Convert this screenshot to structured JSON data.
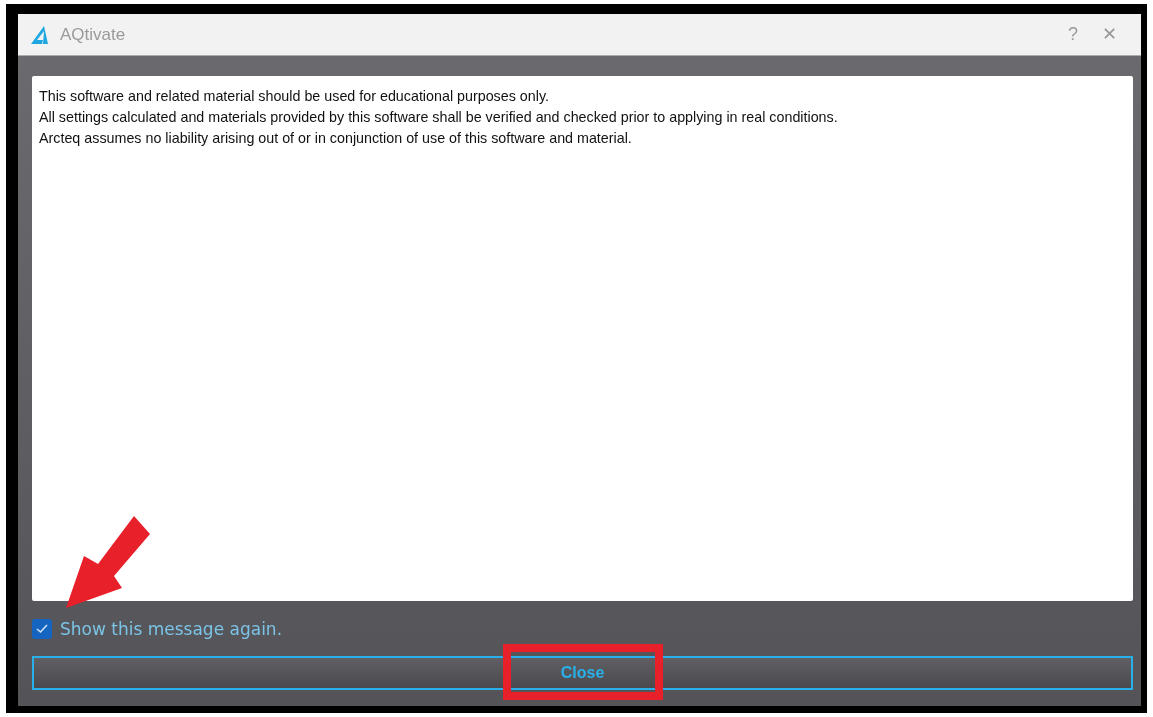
{
  "window": {
    "title": "AQtivate",
    "buttons": [
      "?",
      "✕"
    ]
  },
  "message": {
    "lines": [
      "This software and related material should be used for educational purposes only.",
      "All settings calculated and materials provided by this software shall be verified and checked prior to applying in real conditions.",
      "Arcteq assumes no liability arising out of or in conjunction of use of this software and material."
    ]
  },
  "checkbox": {
    "label": "Show this message again.",
    "checked": true
  },
  "close_button": {
    "label": "Close"
  }
}
